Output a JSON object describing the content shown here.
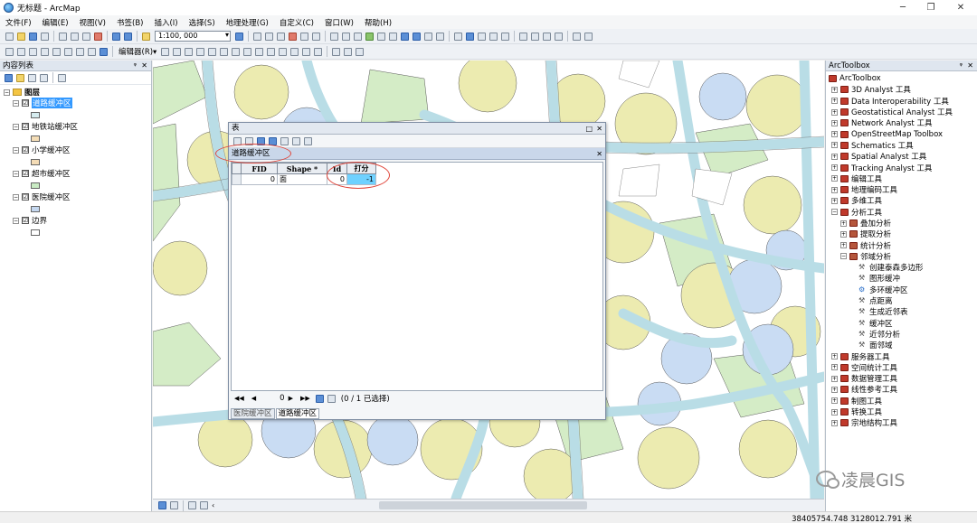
{
  "window": {
    "title": "无标题 - ArcMap",
    "minimize": "─",
    "maximize": "❐",
    "close": "✕"
  },
  "menubar": {
    "items": [
      "文件(F)",
      "编辑(E)",
      "视图(V)",
      "书签(B)",
      "插入(I)",
      "选择(S)",
      "地理处理(G)",
      "自定义(C)",
      "窗口(W)",
      "帮助(H)"
    ]
  },
  "toolbar": {
    "scale": "1:100, 000",
    "editor_label": "编辑器(R)▾"
  },
  "toc": {
    "title": "内容列表",
    "pin": "ᵠ",
    "close": "✕",
    "root_label": "图层",
    "layers": [
      {
        "label": "道路缓冲区",
        "checked": "☑",
        "color": "#d6ecef",
        "selected": true
      },
      {
        "label": "地铁站缓冲区",
        "checked": "☑",
        "color": "#f4ddb6",
        "selected": false
      },
      {
        "label": "小学缓冲区",
        "checked": "☑",
        "color": "#f4dcb6",
        "selected": false
      },
      {
        "label": "超市缓冲区",
        "checked": "☑",
        "color": "#c9ebc3",
        "selected": false
      },
      {
        "label": "医院缓冲区",
        "checked": "☑",
        "color": "#c5d8f0",
        "selected": false
      },
      {
        "label": "边界",
        "checked": "☑",
        "color": "#ffffff",
        "selected": false
      }
    ]
  },
  "table_window": {
    "title": "表",
    "pin": "□",
    "close": "✕",
    "table_name": "道路缓冲区",
    "table_close": "✕",
    "columns": [
      "FID",
      "Shape *",
      "Id",
      "打分"
    ],
    "rows": [
      {
        "fid": "0",
        "shape": "面",
        "id": "0",
        "score": "-1"
      }
    ],
    "nav": {
      "first": "◀◀",
      "prev": "◀",
      "record": "0",
      "next": "▶",
      "last": "▶▶",
      "selection": "(0 / 1 已选择)"
    },
    "tabs": [
      "医院缓冲区",
      "道路缓冲区"
    ]
  },
  "toolbox": {
    "title": "ArcToolbox",
    "pin": "ᵠ",
    "close": "✕",
    "root": "ArcToolbox",
    "items": [
      {
        "label": "3D Analyst 工具",
        "level": 0,
        "exp": "⊞",
        "kind": "box"
      },
      {
        "label": "Data Interoperability 工具",
        "level": 0,
        "exp": "⊞",
        "kind": "box"
      },
      {
        "label": "Geostatistical Analyst 工具",
        "level": 0,
        "exp": "⊞",
        "kind": "box"
      },
      {
        "label": "Network Analyst 工具",
        "level": 0,
        "exp": "⊞",
        "kind": "box"
      },
      {
        "label": "OpenStreetMap Toolbox",
        "level": 0,
        "exp": "⊞",
        "kind": "box"
      },
      {
        "label": "Schematics 工具",
        "level": 0,
        "exp": "⊞",
        "kind": "box"
      },
      {
        "label": "Spatial Analyst 工具",
        "level": 0,
        "exp": "⊞",
        "kind": "box"
      },
      {
        "label": "Tracking Analyst 工具",
        "level": 0,
        "exp": "⊞",
        "kind": "box"
      },
      {
        "label": "编辑工具",
        "level": 0,
        "exp": "⊞",
        "kind": "box"
      },
      {
        "label": "地理编码工具",
        "level": 0,
        "exp": "⊞",
        "kind": "box"
      },
      {
        "label": "多维工具",
        "level": 0,
        "exp": "⊞",
        "kind": "box"
      },
      {
        "label": "分析工具",
        "level": 0,
        "exp": "⊟",
        "kind": "box"
      },
      {
        "label": "叠加分析",
        "level": 1,
        "exp": "⊞",
        "kind": "set"
      },
      {
        "label": "提取分析",
        "level": 1,
        "exp": "⊞",
        "kind": "set"
      },
      {
        "label": "统计分析",
        "level": 1,
        "exp": "⊞",
        "kind": "set"
      },
      {
        "label": "邻域分析",
        "level": 1,
        "exp": "⊟",
        "kind": "set"
      },
      {
        "label": "创建泰森多边形",
        "level": 2,
        "exp": "",
        "kind": "tool"
      },
      {
        "label": "图形缓冲",
        "level": 2,
        "exp": "",
        "kind": "tool"
      },
      {
        "label": "多环缓冲区",
        "level": 2,
        "exp": "",
        "kind": "script"
      },
      {
        "label": "点距离",
        "level": 2,
        "exp": "",
        "kind": "tool"
      },
      {
        "label": "生成近邻表",
        "level": 2,
        "exp": "",
        "kind": "tool"
      },
      {
        "label": "缓冲区",
        "level": 2,
        "exp": "",
        "kind": "tool"
      },
      {
        "label": "近邻分析",
        "level": 2,
        "exp": "",
        "kind": "tool"
      },
      {
        "label": "面邻域",
        "level": 2,
        "exp": "",
        "kind": "tool"
      },
      {
        "label": "服务器工具",
        "level": 0,
        "exp": "⊞",
        "kind": "box"
      },
      {
        "label": "空间统计工具",
        "level": 0,
        "exp": "⊞",
        "kind": "box"
      },
      {
        "label": "数据管理工具",
        "level": 0,
        "exp": "⊞",
        "kind": "box"
      },
      {
        "label": "线性参考工具",
        "level": 0,
        "exp": "⊞",
        "kind": "box"
      },
      {
        "label": "制图工具",
        "level": 0,
        "exp": "⊞",
        "kind": "box"
      },
      {
        "label": "转换工具",
        "level": 0,
        "exp": "⊞",
        "kind": "box"
      },
      {
        "label": "宗地结构工具",
        "level": 0,
        "exp": "⊞",
        "kind": "box"
      }
    ]
  },
  "statusbar": {
    "coords": "38405754.748  3128012.791 米"
  },
  "watermark": {
    "text": "凌晨GIS"
  },
  "colors": {
    "road_buffer": "#b9dde6",
    "yellow_buffer": "#ecebb0",
    "green_buffer": "#d4ecc6",
    "blue_buffer": "#c9dcf3",
    "highlight": "#e0453a",
    "selected_cell": "#6ed1ff"
  }
}
